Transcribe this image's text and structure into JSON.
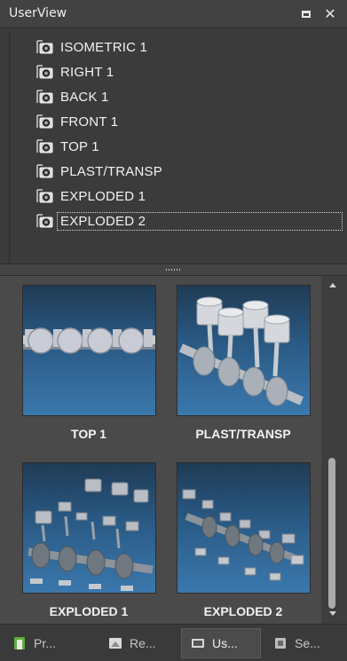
{
  "panel": {
    "title": "UserView"
  },
  "tree": {
    "items": [
      {
        "label": "ISOMETRIC 1"
      },
      {
        "label": "RIGHT 1"
      },
      {
        "label": "BACK 1"
      },
      {
        "label": "FRONT 1"
      },
      {
        "label": "TOP 1"
      },
      {
        "label": "PLAST/TRANSP"
      },
      {
        "label": "EXPLODED 1"
      },
      {
        "label": "EXPLODED 2",
        "selected": true
      }
    ],
    "icon": "camera-icon"
  },
  "thumbnails": [
    {
      "label": "TOP 1"
    },
    {
      "label": "PLAST/TRANSP"
    },
    {
      "label": "EXPLODED 1"
    },
    {
      "label": "EXPLODED 2"
    }
  ],
  "tabs": [
    {
      "label": "Pr...",
      "icon": "properties-icon"
    },
    {
      "label": "Re...",
      "icon": "render-icon"
    },
    {
      "label": "Us...",
      "icon": "userview-icon",
      "active": true
    },
    {
      "label": "Se...",
      "icon": "settings-icon"
    }
  ],
  "colors": {
    "panel_bg": "#3b3b3b",
    "thumb_bg_top": "#1f3b55",
    "thumb_bg_bottom": "#3b78ad",
    "text": "#f2f2f2"
  }
}
